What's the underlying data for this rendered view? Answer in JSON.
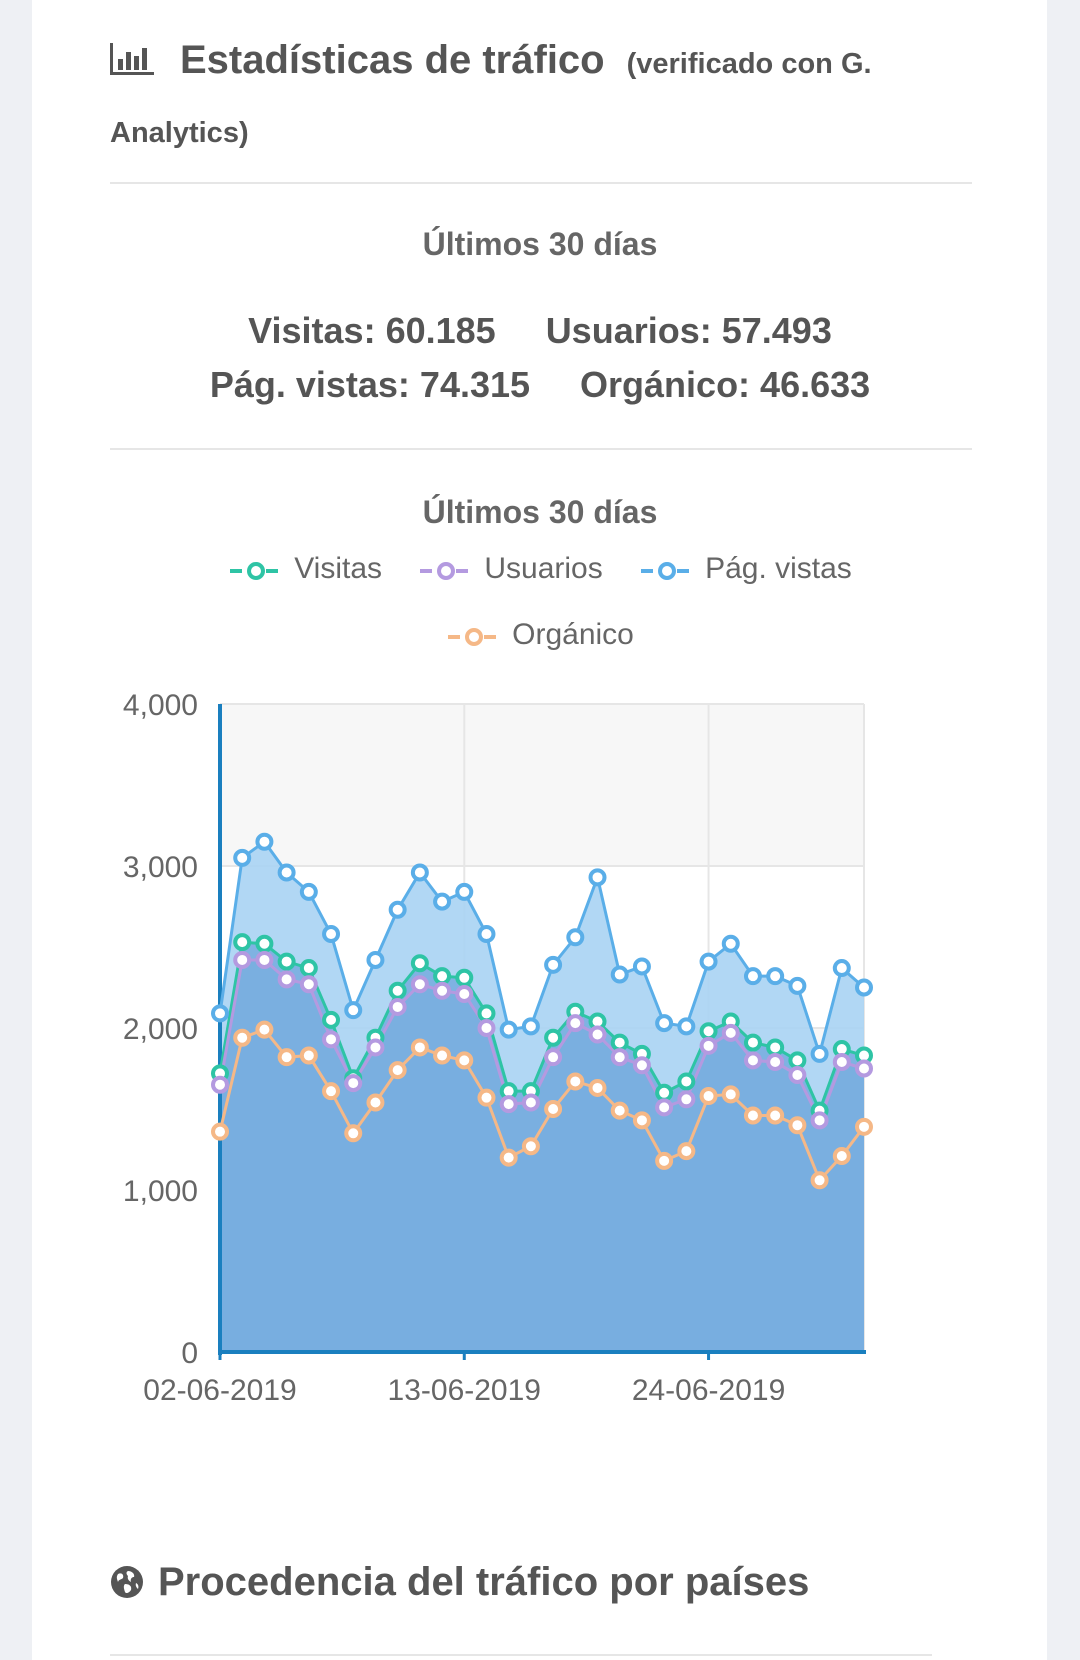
{
  "header": {
    "icon": "bar-chart-icon",
    "title": "Estadísticas de tráfico",
    "subtitle": "(verificado con G. Analytics)"
  },
  "summary": {
    "period_label": "Últimos 30 días",
    "visitas": "Visitas: 60.185",
    "usuarios": "Usuarios: 57.493",
    "pag_vistas": "Pág. vistas: 74.315",
    "organico": "Orgánico: 46.633"
  },
  "chart_data": {
    "type": "area",
    "title": "Últimos 30 días",
    "legend_position": "top",
    "grid": true,
    "x": [
      "02-06-2019",
      "03-06-2019",
      "04-06-2019",
      "05-06-2019",
      "06-06-2019",
      "07-06-2019",
      "08-06-2019",
      "09-06-2019",
      "10-06-2019",
      "11-06-2019",
      "12-06-2019",
      "13-06-2019",
      "14-06-2019",
      "15-06-2019",
      "16-06-2019",
      "17-06-2019",
      "18-06-2019",
      "19-06-2019",
      "20-06-2019",
      "21-06-2019",
      "22-06-2019",
      "23-06-2019",
      "24-06-2019",
      "25-06-2019",
      "26-06-2019",
      "27-06-2019",
      "28-06-2019",
      "29-06-2019",
      "30-06-2019",
      "01-07-2019"
    ],
    "xticks": [
      "02-06-2019",
      "13-06-2019",
      "24-06-2019"
    ],
    "ylim": [
      0,
      4000
    ],
    "yticks": [
      "0",
      "1,000",
      "2,000",
      "3,000",
      "4,000"
    ],
    "series": [
      {
        "name": "Visitas",
        "color": "#2ec4a5",
        "values": [
          1720,
          2530,
          2520,
          2410,
          2370,
          2050,
          1690,
          1940,
          2230,
          2400,
          2320,
          2310,
          2090,
          1610,
          1610,
          1940,
          2100,
          2040,
          1910,
          1840,
          1600,
          1670,
          1980,
          2040,
          1910,
          1880,
          1800,
          1490,
          1870,
          1830
        ]
      },
      {
        "name": "Usuarios",
        "color": "#b49ae0",
        "values": [
          1650,
          2420,
          2420,
          2300,
          2270,
          1930,
          1660,
          1880,
          2130,
          2270,
          2230,
          2210,
          2000,
          1530,
          1540,
          1820,
          2030,
          1960,
          1820,
          1770,
          1510,
          1560,
          1890,
          1970,
          1800,
          1790,
          1710,
          1430,
          1790,
          1750
        ]
      },
      {
        "name": "Pág. vistas",
        "color": "#5aaee8",
        "values": [
          2090,
          3050,
          3150,
          2960,
          2840,
          2580,
          2110,
          2420,
          2730,
          2960,
          2780,
          2840,
          2580,
          1990,
          2010,
          2390,
          2560,
          2930,
          2330,
          2380,
          2030,
          2010,
          2410,
          2520,
          2320,
          2320,
          2260,
          1840,
          2370,
          2250
        ]
      },
      {
        "name": "Orgánico",
        "color": "#f5b887",
        "values": [
          1360,
          1940,
          1990,
          1820,
          1830,
          1610,
          1350,
          1540,
          1740,
          1880,
          1830,
          1800,
          1570,
          1200,
          1270,
          1500,
          1670,
          1630,
          1490,
          1430,
          1180,
          1240,
          1580,
          1590,
          1460,
          1460,
          1400,
          1060,
          1210,
          1390
        ]
      }
    ]
  },
  "section2": {
    "icon": "globe-icon",
    "title": "Procedencia del tráfico por países"
  }
}
